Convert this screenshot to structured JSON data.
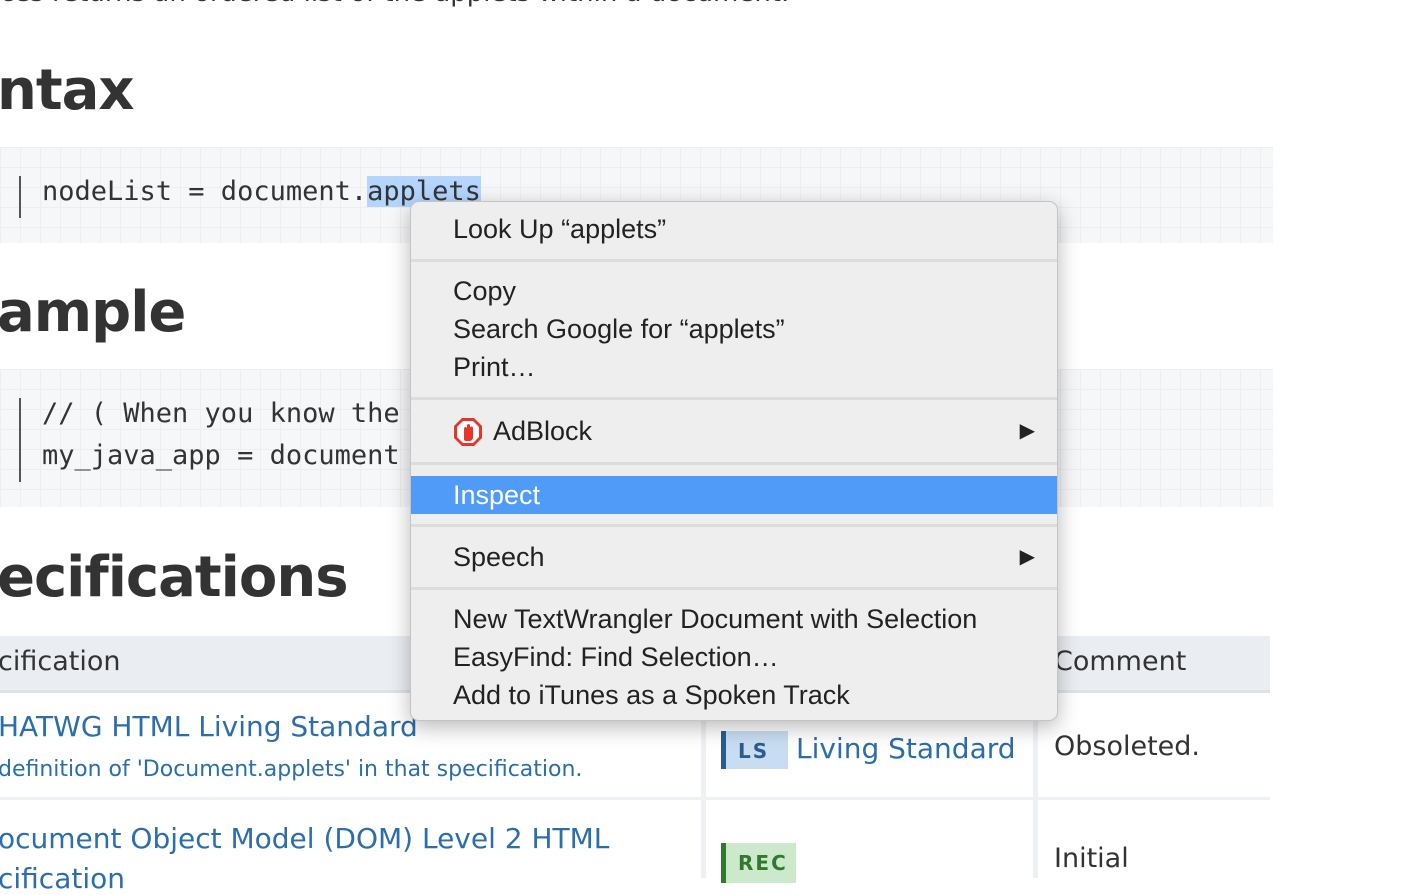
{
  "page": {
    "intro_fragment": "ces returns an ordered list of the applets within a document.",
    "headings": {
      "syntax": "ntax",
      "example": "ample",
      "specifications": "ecifications"
    },
    "syntax_code": {
      "before": "nodeList = document.",
      "selected": "applets"
    },
    "example_code": {
      "line1": "// ( When you know the",
      "line2": "my_java_app = document"
    },
    "table": {
      "headers": [
        "cification",
        "Comment"
      ],
      "rows": [
        {
          "spec_title": "HATWG HTML Living Standard",
          "spec_sub": "definition of 'Document.applets' in that specification.",
          "status_badge": "LS",
          "status_text": "Living Standard",
          "comment": "Obsoleted."
        },
        {
          "spec_title": "ocument Object Model (DOM) Level 2 HTML",
          "spec_sub": "cification",
          "status_badge": "REC",
          "status_text": "",
          "comment": "Initial"
        }
      ]
    }
  },
  "context_menu": {
    "items": [
      {
        "label": "Look Up “applets”"
      },
      {
        "label": "Copy"
      },
      {
        "label": "Search Google for “applets”"
      },
      {
        "label": "Print…"
      },
      {
        "label": "AdBlock",
        "icon": "adblock-icon",
        "submenu": true
      },
      {
        "label": "Inspect",
        "highlighted": true
      },
      {
        "label": "Speech",
        "submenu": true
      },
      {
        "label": "New TextWrangler Document with Selection"
      },
      {
        "label": "EasyFind: Find Selection…"
      },
      {
        "label": "Add to iTunes as a Spoken Track"
      }
    ],
    "submenu_arrow": "▶",
    "highlight_color": "#4f9bf7"
  }
}
